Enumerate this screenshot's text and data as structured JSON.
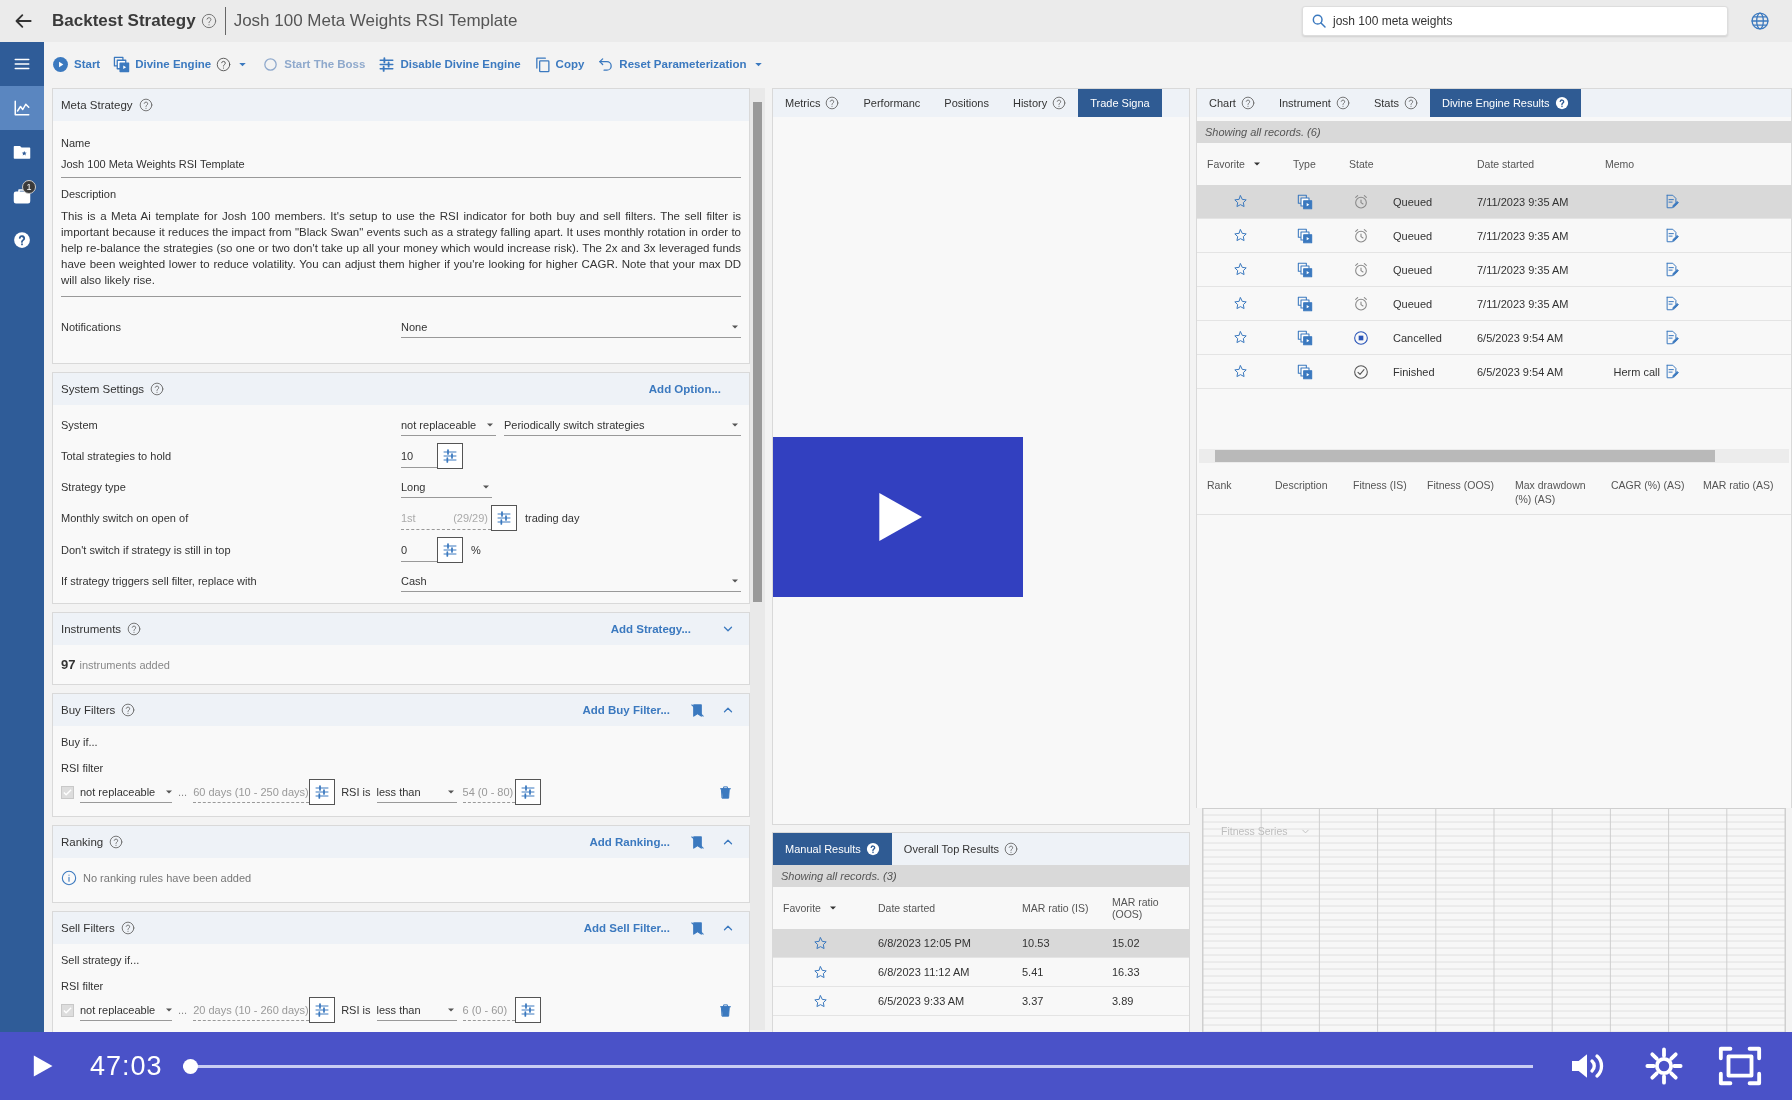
{
  "header": {
    "title": "Backtest Strategy",
    "subtitle": "Josh 100 Meta Weights RSI Template",
    "search": {
      "value": "josh 100 meta weights"
    }
  },
  "nav": {
    "items": [
      {
        "kind": "menu",
        "selected": false
      },
      {
        "kind": "chart",
        "selected": true
      },
      {
        "kind": "folder",
        "selected": false
      },
      {
        "kind": "briefcase",
        "selected": false,
        "badge": "1"
      },
      {
        "kind": "help",
        "selected": false
      }
    ]
  },
  "toolbar": [
    {
      "kind": "start",
      "label": "Start",
      "disabled": false,
      "help": false,
      "dropdown": false
    },
    {
      "kind": "engine",
      "label": "Divine Engine",
      "disabled": false,
      "help": true,
      "dropdown": true
    },
    {
      "kind": "boss",
      "label": "Start The Boss",
      "disabled": true,
      "help": false,
      "dropdown": false
    },
    {
      "kind": "sliders",
      "label": "Disable Divine Engine",
      "disabled": false,
      "help": false,
      "dropdown": false
    },
    {
      "kind": "copy",
      "label": "Copy",
      "disabled": false,
      "help": false,
      "dropdown": false
    },
    {
      "kind": "reset",
      "label": "Reset Parameterization",
      "disabled": false,
      "help": false,
      "dropdown": true
    }
  ],
  "meta_strategy": {
    "title": "Meta Strategy",
    "name_label": "Name",
    "name": "Josh 100 Meta Weights RSI Template",
    "description_label": "Description",
    "description": "This is a Meta Ai template for Josh 100 members. It's setup to use the RSI indicator for both buy and sell filters. The sell filter is important because it reduces the impact from \"Black Swan\" events such as a strategy falling apart. It uses monthly rotation in order to help re-balance the strategies (so one or two don't take up all your money which would increase risk). The 2x and 3x leveraged funds have been weighted lower to reduce volatility. You can adjust them higher if you're looking for higher CAGR. Note that your max DD will also likely rise.",
    "notifications_label": "Notifications",
    "notifications": "None"
  },
  "system_settings": {
    "title": "System Settings",
    "action": "Add Option...",
    "rows": [
      {
        "kind": "double-select",
        "label": "System",
        "values": [
          "not replaceable",
          "Periodically switch strategies"
        ]
      },
      {
        "kind": "spin",
        "label": "Total strategies to hold",
        "value": "10",
        "disabled": false
      },
      {
        "kind": "select",
        "label": "Strategy type",
        "value": "Long"
      },
      {
        "kind": "spin",
        "label": "Monthly switch on open of",
        "value": "1st",
        "range": "(29/29)",
        "suffix": "trading day",
        "disabled": true
      },
      {
        "kind": "spin",
        "label": "Don't switch if strategy is still in top",
        "value": "0",
        "suffix": "%",
        "disabled": false
      },
      {
        "kind": "select-wide",
        "label": "If strategy triggers sell filter, replace with",
        "value": "Cash"
      }
    ]
  },
  "instruments": {
    "title": "Instruments",
    "action": "Add Strategy...",
    "expanded": false,
    "count": "97",
    "count_label": "instruments added"
  },
  "buy_filters": {
    "title": "Buy Filters",
    "action": "Add Buy Filter...",
    "expanded": true,
    "intro": "Buy if...",
    "filters": [
      {
        "name": "RSI filter",
        "checked": true,
        "mode": "not replaceable",
        "separator": "...",
        "period": "60 days (10 - 250 days)",
        "is_label": "RSI is",
        "comparison": "less than",
        "threshold": "54 (0 - 80)"
      }
    ]
  },
  "ranking": {
    "title": "Ranking",
    "action": "Add Ranking...",
    "expanded": true,
    "message": "No ranking rules have been added"
  },
  "sell_filters": {
    "title": "Sell Filters",
    "action": "Add Sell Filter...",
    "expanded": true,
    "intro": "Sell strategy if...",
    "filters": [
      {
        "name": "RSI filter",
        "checked": true,
        "mode": "not replaceable",
        "separator": "...",
        "period": "20 days (10 - 260 days)",
        "is_label": "RSI is",
        "comparison": "less than",
        "threshold": "6 (0 - 60)"
      }
    ]
  },
  "signals_panel": {
    "tabs": [
      {
        "label": "Metrics",
        "help": true,
        "selected": false
      },
      {
        "label": "Performanc",
        "help": false,
        "selected": false
      },
      {
        "label": "Positions",
        "help": false,
        "selected": false
      },
      {
        "label": "History",
        "help": true,
        "selected": false
      },
      {
        "label": "Trade Signa",
        "help": false,
        "selected": true
      }
    ]
  },
  "manual_results": {
    "tabs": [
      {
        "label": "Manual Results",
        "help": true,
        "selected": true
      },
      {
        "label": "Overall Top Results",
        "help": true,
        "selected": false
      }
    ],
    "status": "Showing all records. (3)",
    "favorite_column": "Favorite",
    "columns": [
      "Date started",
      "MAR ratio (IS)",
      "MAR ratio (OOS)"
    ],
    "rows": [
      {
        "selected": true,
        "favorite": false,
        "cells": [
          "6/8/2023 12:05 PM",
          "10.53",
          "15.02"
        ]
      },
      {
        "selected": false,
        "favorite": false,
        "cells": [
          "6/8/2023 11:12 AM",
          "5.41",
          "16.33"
        ]
      },
      {
        "selected": false,
        "favorite": false,
        "cells": [
          "6/5/2023 9:33 AM",
          "3.37",
          "3.89"
        ]
      }
    ]
  },
  "results_panel": {
    "tabs": [
      {
        "label": "Chart",
        "help": true,
        "selected": false
      },
      {
        "label": "Instrument",
        "help": true,
        "selected": false
      },
      {
        "label": "Stats",
        "help": true,
        "selected": false
      },
      {
        "label": "Divine Engine Results",
        "help": true,
        "selected": true
      }
    ],
    "status": "Showing all records. (6)",
    "columns": [
      "Favorite",
      "Type",
      "State",
      "Date started",
      "Memo"
    ],
    "rows": [
      {
        "selected": true,
        "favorite": false,
        "kind": "queued",
        "state_label": "Queued",
        "date": "7/11/2023 9:35 AM"
      },
      {
        "selected": false,
        "favorite": false,
        "kind": "queued",
        "state_label": "Queued",
        "date": "7/11/2023 9:35 AM"
      },
      {
        "selected": false,
        "favorite": false,
        "kind": "queued",
        "state_label": "Queued",
        "date": "7/11/2023 9:35 AM"
      },
      {
        "selected": false,
        "favorite": false,
        "kind": "queued",
        "state_label": "Queued",
        "date": "7/11/2023 9:35 AM"
      },
      {
        "selected": false,
        "favorite": false,
        "kind": "cancelled",
        "state_label": "Cancelled",
        "date": "6/5/2023 9:54 AM"
      },
      {
        "selected": false,
        "favorite": false,
        "kind": "finished",
        "state_label": "Finished",
        "date": "6/5/2023 9:54 AM",
        "memo": "Herm call"
      }
    ]
  },
  "ranking_table": {
    "columns": [
      "Rank",
      "Description",
      "Fitness (IS)",
      "Fitness (OOS)",
      "Max drawdown (%) (AS)",
      "CAGR (%) (AS)",
      "MAR ratio (AS)"
    ]
  },
  "fitness_chart": {
    "series_select": "Fitness Series"
  },
  "player": {
    "time": "47:03",
    "level": 0
  }
}
